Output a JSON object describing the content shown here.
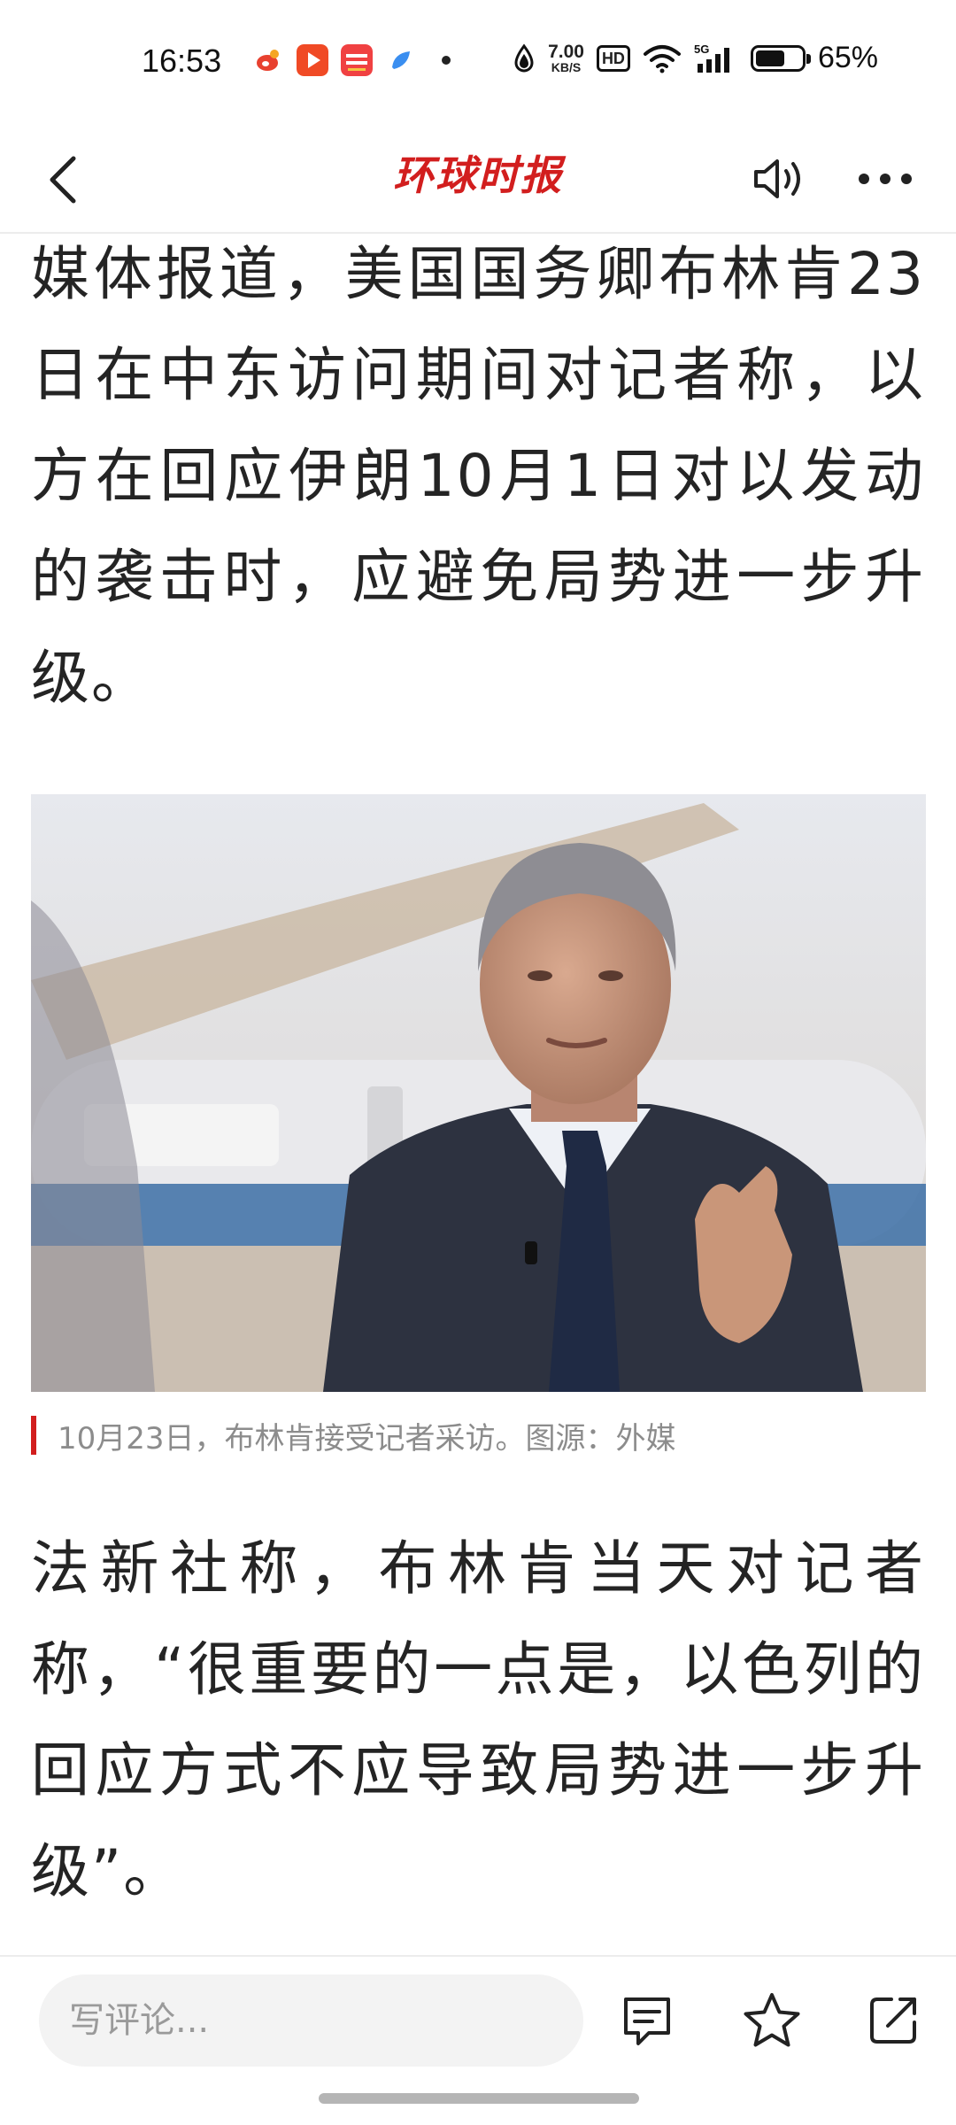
{
  "status_bar": {
    "time": "16:53",
    "notification_icons": [
      "weibo-app-icon",
      "video-app-icon",
      "toutiao-app-icon",
      "blue-app-icon"
    ],
    "network_speed_value": "7.00",
    "network_speed_unit": "KB/S",
    "hd_label": "HD",
    "signal_label": "5G",
    "battery_percent": 65,
    "battery_text": "65%"
  },
  "header": {
    "brand": "环球时报"
  },
  "article": {
    "paragraph_1": "媒体报道，美国国务卿布林肯23日在中东访问期间对记者称，以方在回应伊朗10月1日对以发动的袭击时，应避免局势进一步升级。",
    "photo_caption": "10月23日，布林肯接受记者采访。图源：外媒",
    "paragraph_2": "法新社称，布林肯当天对记者称，“很重要的一点是，以色列的回应方式不应导致局势进一步升级”。"
  },
  "bottom_bar": {
    "comment_placeholder": "写评论..."
  },
  "colors": {
    "brand_red": "#d21e1e",
    "body_text": "#242424",
    "caption_text": "#8c8c8c"
  }
}
